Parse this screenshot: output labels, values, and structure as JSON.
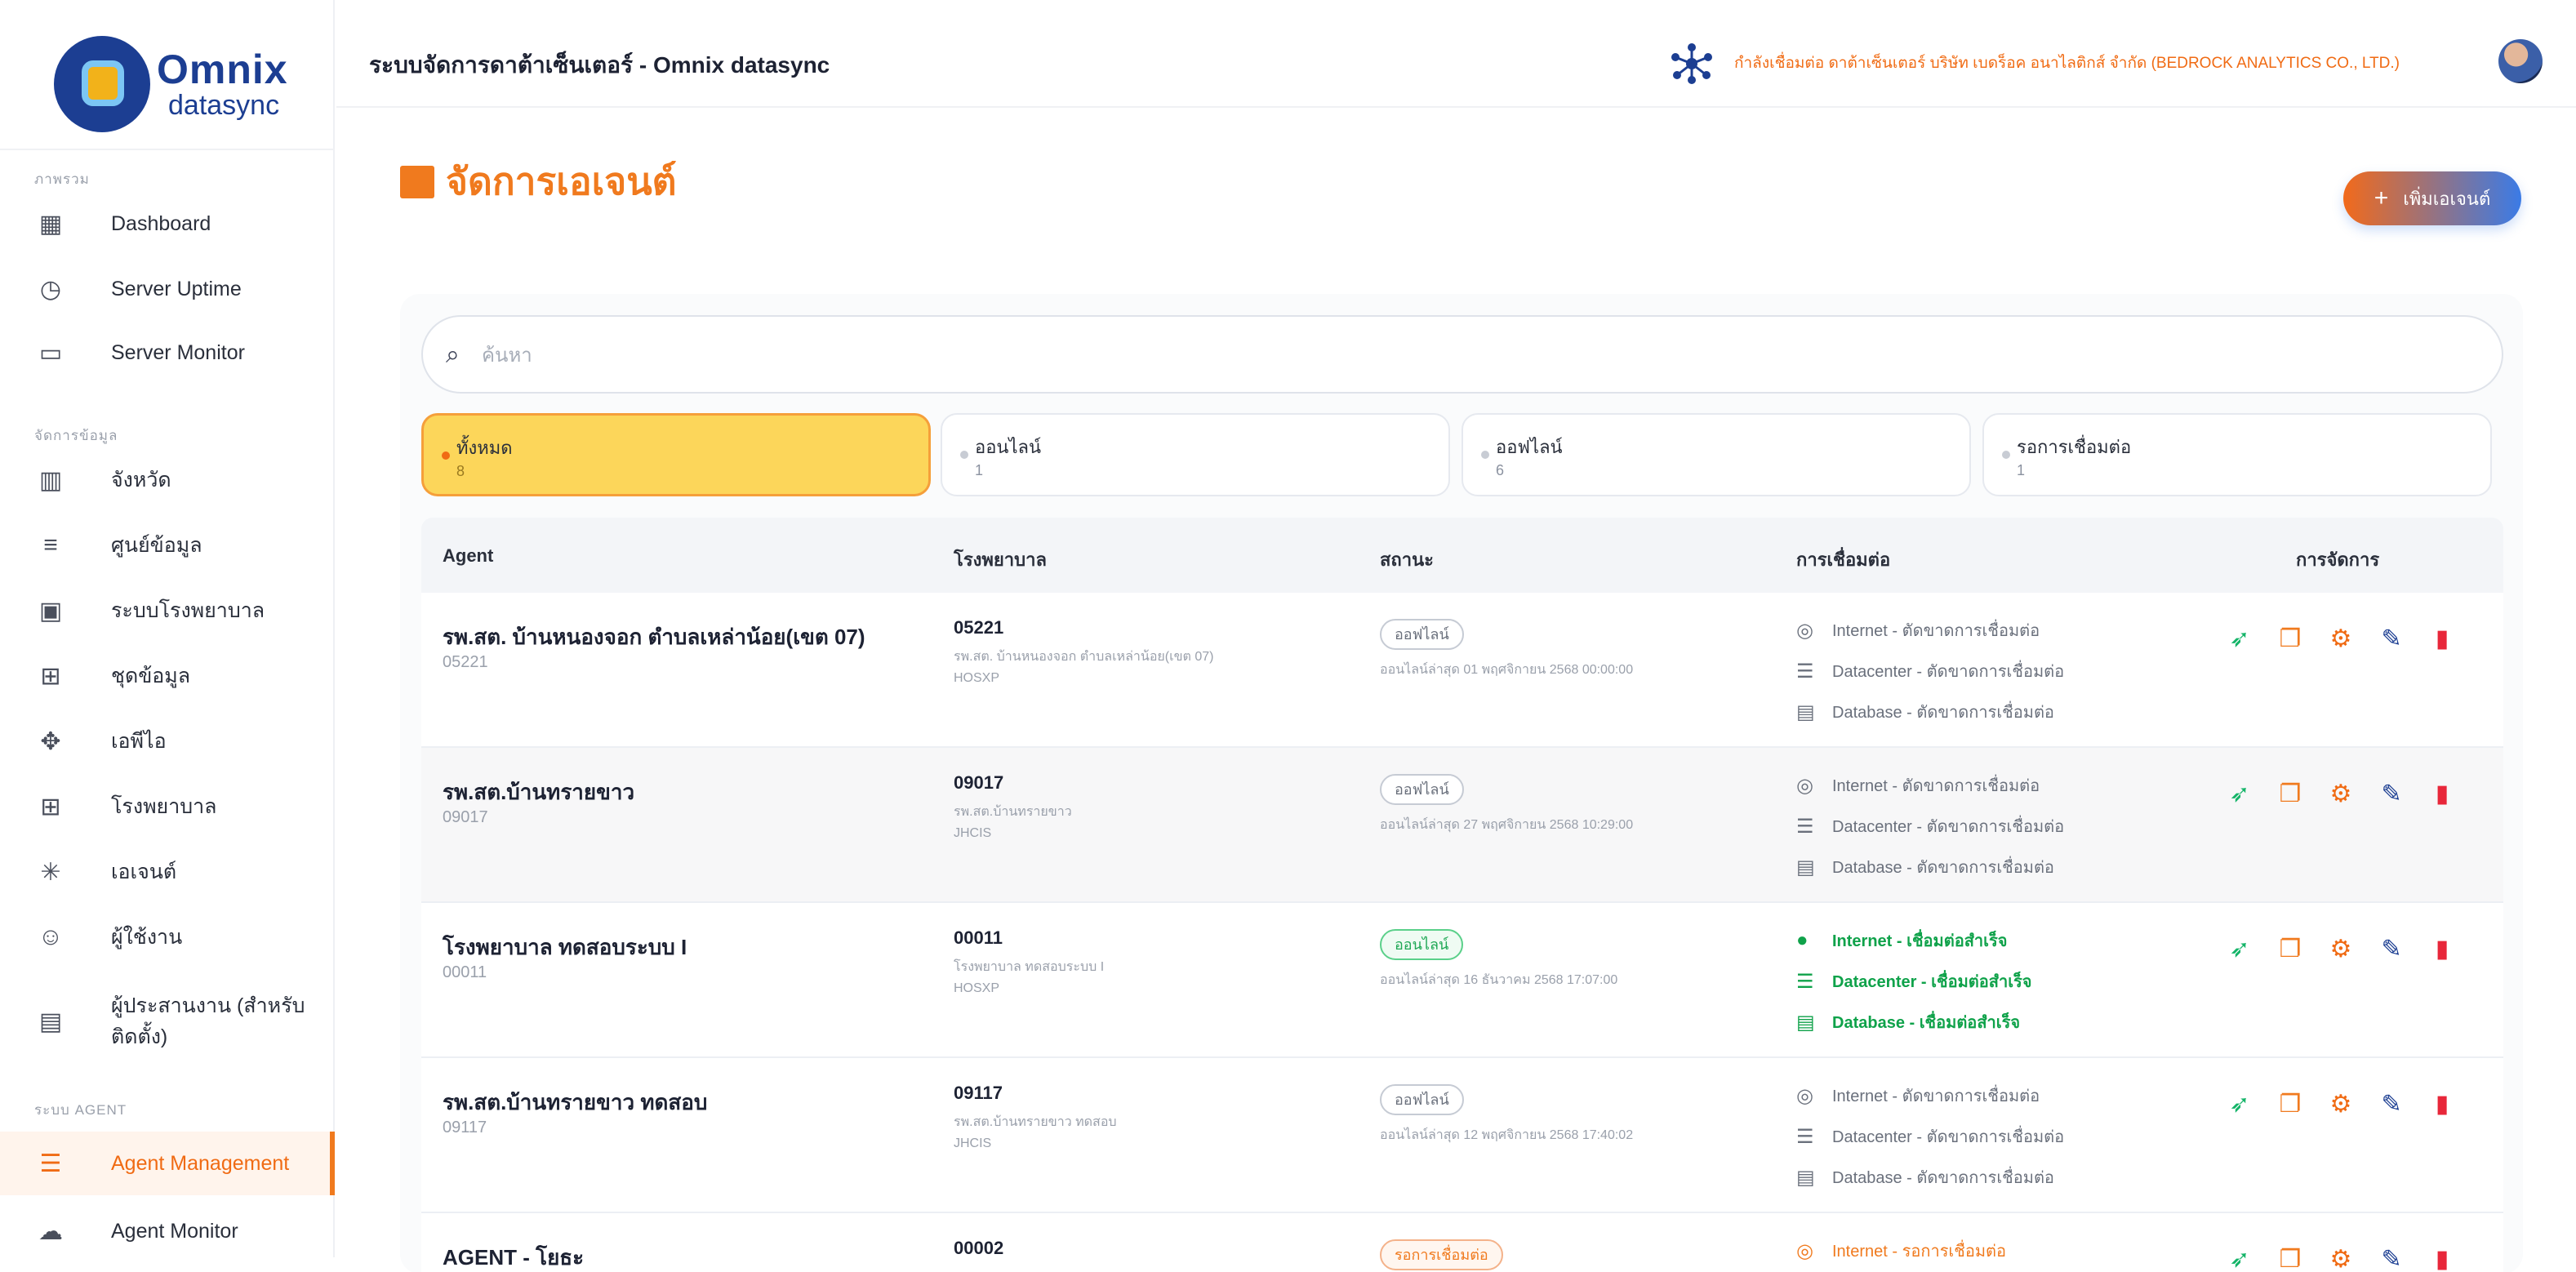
{
  "brand": {
    "name": "Omnix",
    "sub": "datasync"
  },
  "sidebar": {
    "sections": [
      {
        "label": "ภาพรวม",
        "items": [
          {
            "label": "Dashboard",
            "icon": "grid-icon"
          },
          {
            "label": "Server Uptime",
            "icon": "clock-icon"
          },
          {
            "label": "Server Monitor",
            "icon": "monitor-icon"
          }
        ]
      },
      {
        "label": "จัดการข้อมูล",
        "items": [
          {
            "label": "จังหวัด",
            "icon": "map-icon"
          },
          {
            "label": "ศูนย์ข้อมูล",
            "icon": "list-icon"
          },
          {
            "label": "ระบบโรงพยาบาล",
            "icon": "hospital-system-icon"
          },
          {
            "label": "ชุดข้อมูล",
            "icon": "dataset-icon"
          },
          {
            "label": "เอพีไอ",
            "icon": "api-icon"
          },
          {
            "label": "โรงพยาบาล",
            "icon": "hospital-icon"
          },
          {
            "label": "เอเจนต์",
            "icon": "agent-icon"
          },
          {
            "label": "ผู้ใช้งาน",
            "icon": "users-icon"
          },
          {
            "label": "ผู้ประสานงาน (สำหรับ ติดตั้ง)",
            "icon": "contact-card-icon"
          }
        ]
      },
      {
        "label": "ระบบ AGENT",
        "items": [
          {
            "label": "Agent Management",
            "icon": "server-icon"
          },
          {
            "label": "Agent Monitor",
            "icon": "cloud-icon"
          }
        ]
      }
    ]
  },
  "topbar": {
    "title": "ระบบจัดการดาต้าเซ็นเตอร์ - Omnix datasync",
    "connection_text": "กำลังเชื่อมต่อ ดาต้าเซ็นเตอร์ บริษัท เบดร็อค อนาไลติกส์ จำกัด (BEDROCK ANALYTICS CO., LTD.)"
  },
  "page": {
    "title": "จัดการเอเจนต์",
    "add_button": "เพิ่มเอเจนต์"
  },
  "search": {
    "placeholder": "ค้นหา"
  },
  "filters": [
    {
      "label": "ทั้งหมด",
      "count": "8"
    },
    {
      "label": "ออนไลน์",
      "count": "1"
    },
    {
      "label": "ออฟไลน์",
      "count": "6"
    },
    {
      "label": "รอการเชื่อมต่อ",
      "count": "1"
    }
  ],
  "table": {
    "headers": [
      "Agent",
      "โรงพยาบาล",
      "สถานะ",
      "การเชื่อมต่อ",
      "การจัดการ"
    ],
    "rows": [
      {
        "agent_name": "รพ.สต. บ้านหนองจอก ตำบลเหล่าน้อย(เขต 07)",
        "agent_code": "05221",
        "hospital_code": "05221",
        "hospital_name": "รพ.สต. บ้านหนองจอก ตำบลเหล่าน้อย(เขต 07)",
        "hospital_system": "HOSXP",
        "status": "ออฟไลน์",
        "last_online": "ออนไลน์ล่าสุด 01 พฤศจิกายน 2568 00:00:00",
        "internet": "Internet - ตัดขาดการเชื่อมต่อ",
        "datacenter": "Datacenter - ตัดขาดการเชื่อมต่อ",
        "database": "Database - ตัดขาดการเชื่อมต่อ"
      },
      {
        "agent_name": "รพ.สต.บ้านทรายขาว",
        "agent_code": "09017",
        "hospital_code": "09017",
        "hospital_name": "รพ.สต.บ้านทรายขาว",
        "hospital_system": "JHCIS",
        "status": "ออฟไลน์",
        "last_online": "ออนไลน์ล่าสุด 27 พฤศจิกายน 2568 10:29:00",
        "internet": "Internet - ตัดขาดการเชื่อมต่อ",
        "datacenter": "Datacenter - ตัดขาดการเชื่อมต่อ",
        "database": "Database - ตัดขาดการเชื่อมต่อ"
      },
      {
        "agent_name": "โรงพยาบาล ทดสอบระบบ I",
        "agent_code": "00011",
        "hospital_code": "00011",
        "hospital_name": "โรงพยาบาล ทดสอบระบบ I",
        "hospital_system": "HOSXP",
        "status": "ออนไลน์",
        "last_online": "ออนไลน์ล่าสุด 16 ธันวาคม 2568 17:07:00",
        "internet": "Internet - เชื่อมต่อสำเร็จ",
        "datacenter": "Datacenter - เชื่อมต่อสำเร็จ",
        "database": "Database - เชื่อมต่อสำเร็จ"
      },
      {
        "agent_name": "รพ.สต.บ้านทรายขาว ทดสอบ",
        "agent_code": "09117",
        "hospital_code": "09117",
        "hospital_name": "รพ.สต.บ้านทรายขาว ทดสอบ",
        "hospital_system": "JHCIS",
        "status": "ออฟไลน์",
        "last_online": "ออนไลน์ล่าสุด 12 พฤศจิกายน 2568 17:40:02",
        "internet": "Internet - ตัดขาดการเชื่อมต่อ",
        "datacenter": "Datacenter - ตัดขาดการเชื่อมต่อ",
        "database": "Database - ตัดขาดการเชื่อมต่อ"
      },
      {
        "agent_name": "AGENT - โยธะ",
        "hospital_code": "00002",
        "status": "รอการเชื่อมต่อ",
        "internet": "Internet - รอการเชื่อมต่อ"
      }
    ]
  }
}
